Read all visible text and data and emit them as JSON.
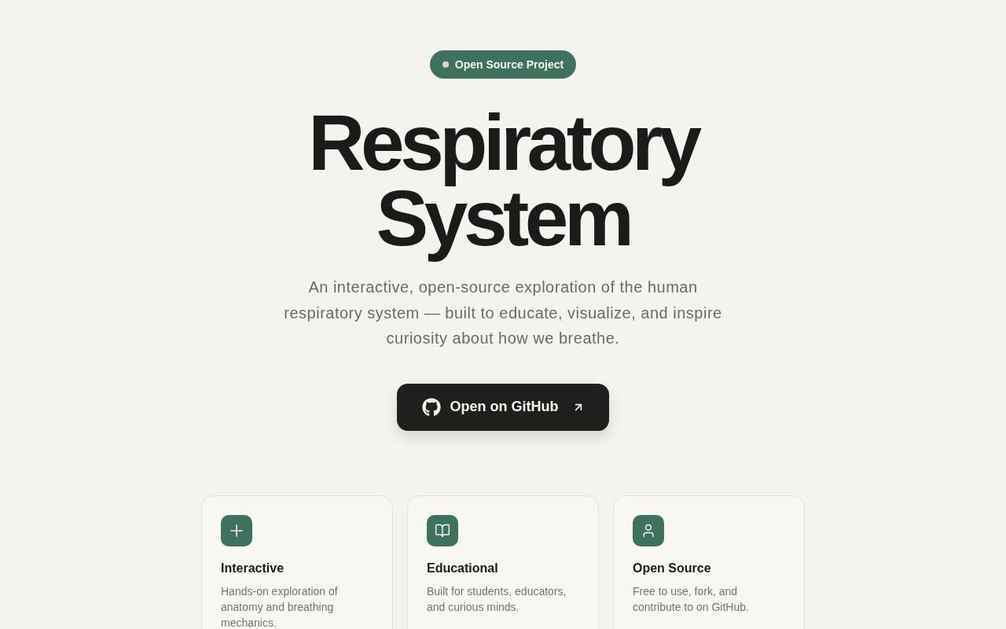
{
  "badge": {
    "label": "Open Source Project"
  },
  "hero": {
    "title": "Respiratory System",
    "subtitle": "An interactive, open-source exploration of the human respiratory system — built to educate, visualize, and inspire curiosity about how we breathe.",
    "cta": {
      "label": "Open on GitHub"
    }
  },
  "features": [
    {
      "title": "Interactive",
      "description": "Hands-on exploration of anatomy and breathing mechanics."
    },
    {
      "title": "Educational",
      "description": "Built for students, educators, and curious minds."
    },
    {
      "title": "Open Source",
      "description": "Free to use, fork, and contribute to on GitHub."
    }
  ]
}
